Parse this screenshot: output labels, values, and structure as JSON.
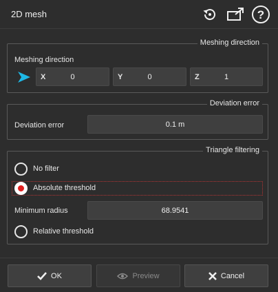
{
  "window": {
    "title": "2D mesh"
  },
  "toolbar": {
    "reset_icon": "reset-icon",
    "popout_icon": "popout-icon",
    "help_icon": "help-icon"
  },
  "meshing": {
    "group_title": "Meshing direction",
    "label": "Meshing direction",
    "x": {
      "axis": "X",
      "value": "0"
    },
    "y": {
      "axis": "Y",
      "value": "0"
    },
    "z": {
      "axis": "Z",
      "value": "1"
    }
  },
  "deviation": {
    "group_title": "Deviation error",
    "label": "Deviation error",
    "value": "0.1 m"
  },
  "filtering": {
    "group_title": "Triangle filtering",
    "no_filter": "No filter",
    "absolute": "Absolute threshold",
    "min_radius_label": "Minimum radius",
    "min_radius_value": "68.9541",
    "relative": "Relative threshold",
    "selected": "absolute"
  },
  "footer": {
    "ok": "OK",
    "preview": "Preview",
    "cancel": "Cancel"
  },
  "colors": {
    "accent": "#1eb8e6",
    "radio_dot": "#e02020",
    "background": "#2d2d2d"
  }
}
